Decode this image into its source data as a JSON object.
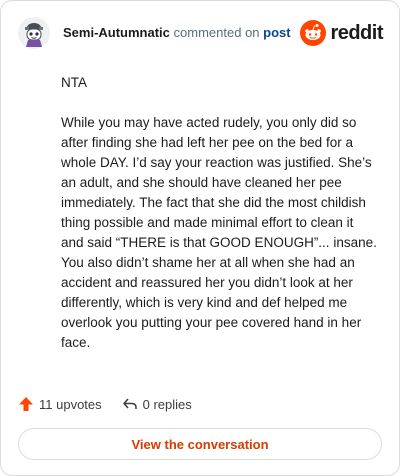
{
  "header": {
    "username": "Semi-Autumnatic",
    "verb": "commented on",
    "link": "post",
    "brand": "reddit"
  },
  "comment": {
    "paragraphs": [
      "NTA",
      "While you may have acted rudely, you only did so after finding she had left her pee on the bed for a whole DAY. I’d say your reaction was justified. She’s an adult, and she should have cleaned her pee immediately. The fact that she did the most childish thing possible and made minimal effort to clean it and said “THERE is that GOOD ENOUGH”... insane. You also didn’t shame her at all when she had an accident and reassured her you didn’t look at her differently, which is very kind and def helped me overlook you putting your pee covered hand in her face."
    ]
  },
  "footer": {
    "upvotes": "11 upvotes",
    "replies": "0 replies"
  },
  "cta": {
    "label": "View the conversation"
  },
  "icons": {
    "avatar": "avatar-icon",
    "brand": "reddit-logo-icon",
    "upvote": "upvote-arrow-icon",
    "reply": "reply-arrow-icon"
  },
  "colors": {
    "brand": "#ff4500",
    "cta_text": "#d93a00",
    "link": "#0a449b"
  }
}
